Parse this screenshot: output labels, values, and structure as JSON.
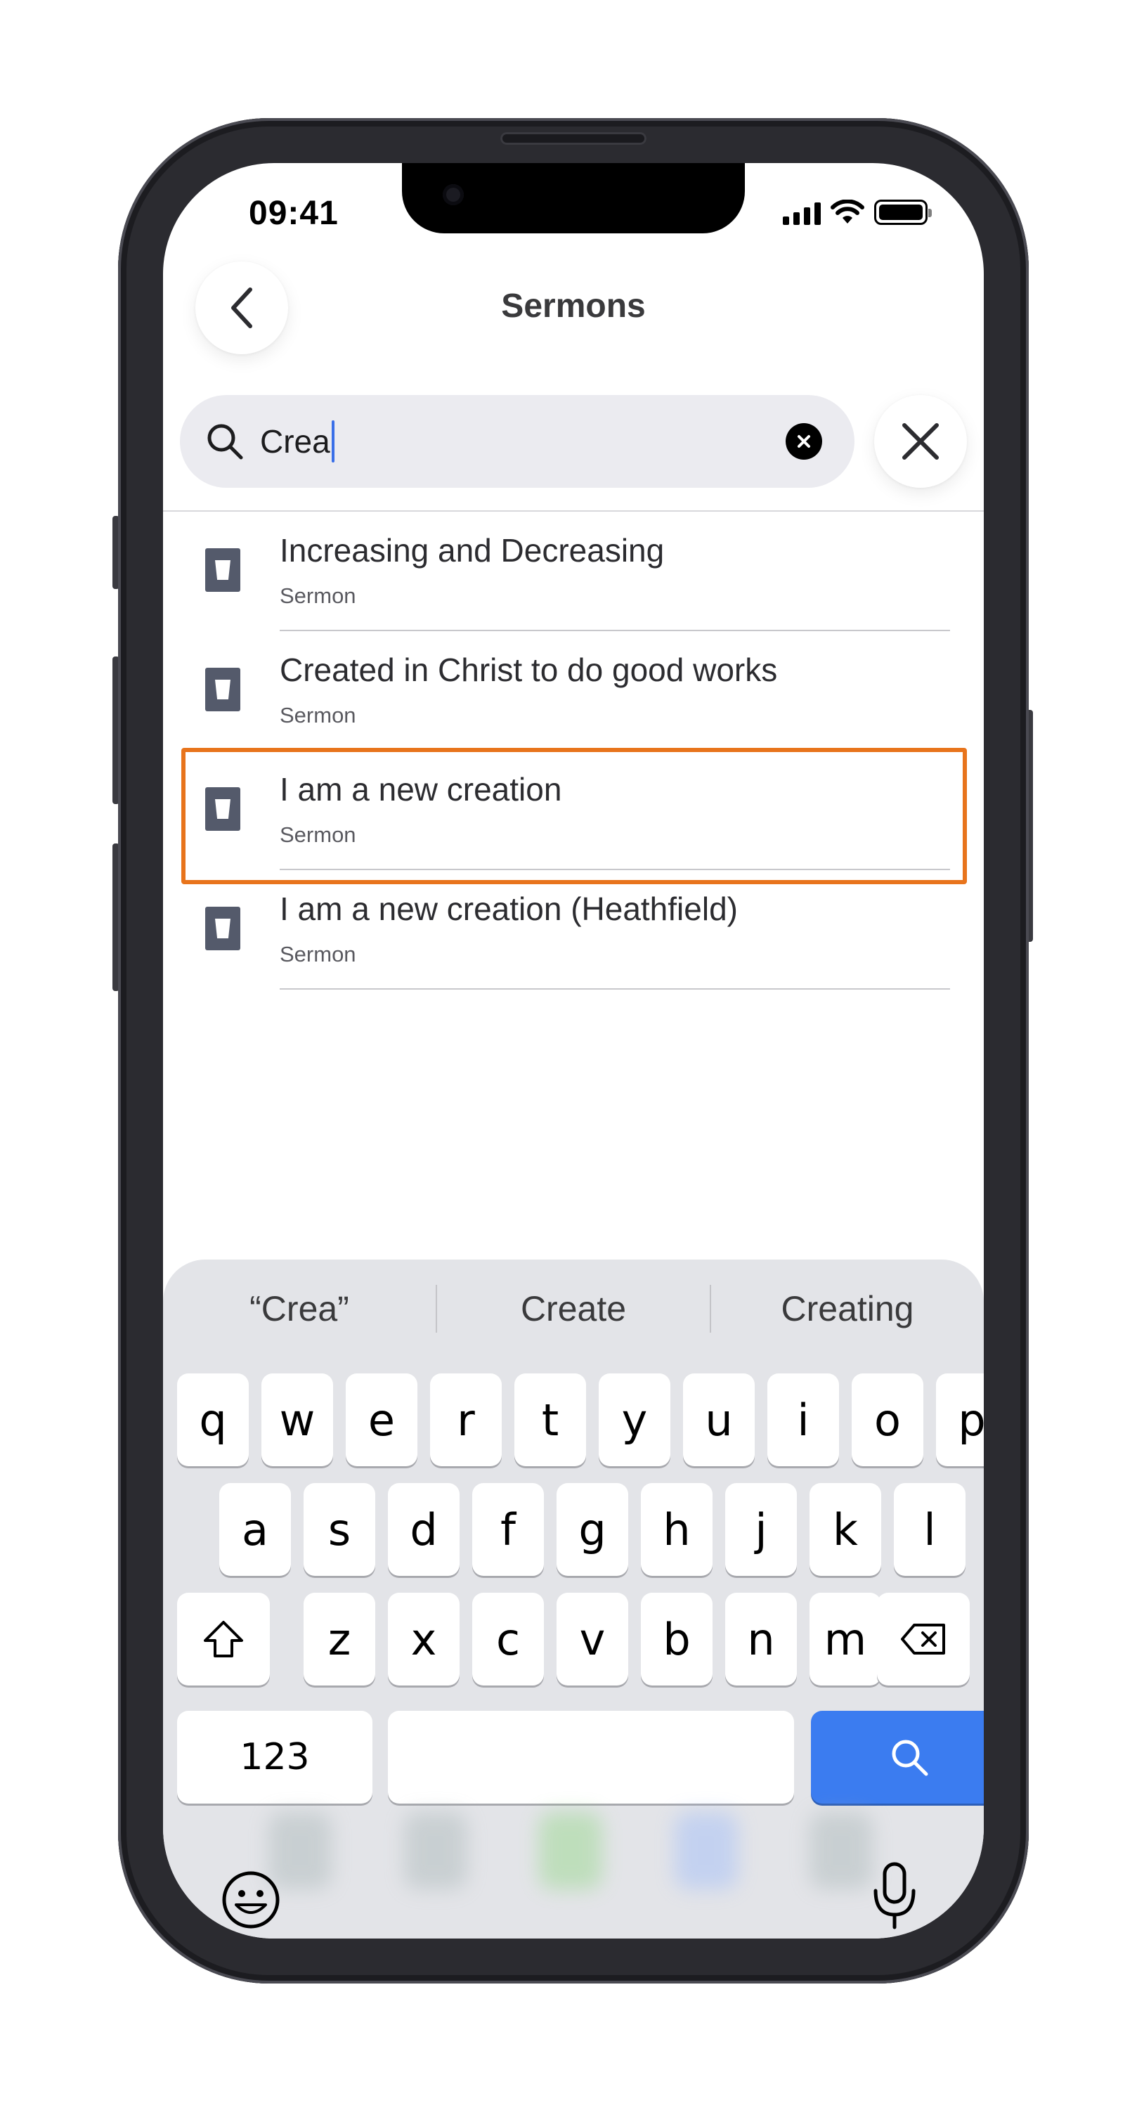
{
  "status_bar": {
    "time": "09:41"
  },
  "header": {
    "title": "Sermons",
    "back_icon": "chevron-left-icon"
  },
  "search": {
    "query": "Crea",
    "clear_icon": "clear-circle-icon",
    "close_icon": "close-x-icon"
  },
  "results": [
    {
      "title": "Increasing and Decreasing",
      "subtitle": "Sermon",
      "icon": "sermon-cup-icon"
    },
    {
      "title": "Created in Christ to do good works",
      "subtitle": "Sermon",
      "icon": "sermon-cup-icon"
    },
    {
      "title": "I am a new creation",
      "subtitle": "Sermon",
      "icon": "sermon-cup-icon",
      "highlighted": true
    },
    {
      "title": "I am a new creation (Heathfield)",
      "subtitle": "Sermon",
      "icon": "sermon-cup-icon"
    }
  ],
  "highlight_color": "#e8741c",
  "keyboard": {
    "suggestions": [
      "“Crea”",
      "Create",
      "Creating"
    ],
    "row1": [
      "q",
      "w",
      "e",
      "r",
      "t",
      "y",
      "u",
      "i",
      "o",
      "p"
    ],
    "row2": [
      "a",
      "s",
      "d",
      "f",
      "g",
      "h",
      "j",
      "k",
      "l"
    ],
    "row3": [
      "z",
      "x",
      "c",
      "v",
      "b",
      "n",
      "m"
    ],
    "numbers_key": "123",
    "search_key_icon": "search-icon",
    "accent": "#3b7cf0"
  }
}
